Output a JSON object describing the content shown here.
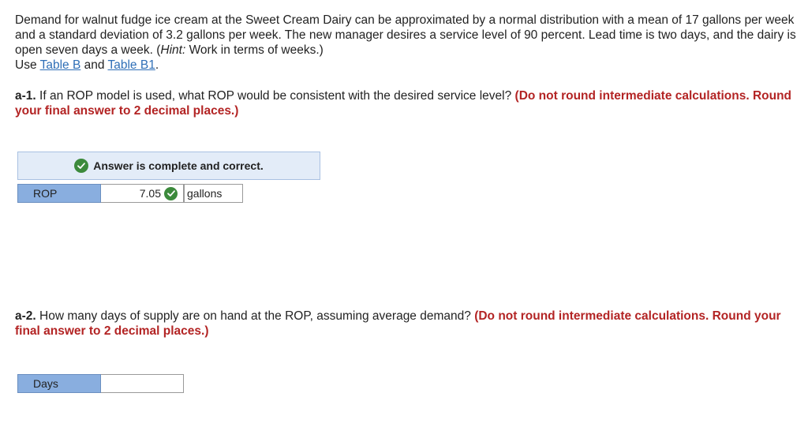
{
  "problem": {
    "text": "Demand for walnut fudge ice cream at the Sweet Cream Dairy can be approximated by a normal distribution with a mean of 17 gallons per week and a standard deviation of 3.2 gallons per week. The new manager desires a service level of 90 percent. Lead time is two days, and the dairy is open seven days a week. (",
    "hint_label": "Hint:",
    "hint_text": " Work in terms of weeks.)",
    "use_label": "Use ",
    "link1": "Table B",
    "and": " and ",
    "link2": "Table B1",
    "period": "."
  },
  "a1": {
    "num": "a-1.",
    "question": " If an ROP model is used, what ROP would be consistent with the desired service level? ",
    "instruction": "(Do not round intermediate calculations. Round your final answer to 2 decimal places.)",
    "banner": "Answer is complete and correct.",
    "row_label": "ROP",
    "value": "7.05",
    "unit": "gallons"
  },
  "a2": {
    "num": "a-2.",
    "question": " How many days of supply are on hand at the ROP, assuming average demand? ",
    "instruction": "(Do not round intermediate calculations. Round your final answer to 2 decimal places.)",
    "row_label": "Days",
    "value": ""
  },
  "colors": {
    "link": "#2f6fb7",
    "instruction": "#b32424",
    "label_bg": "#89aedf",
    "banner_bg": "#e3ecf8",
    "check": "#3c8a3c"
  }
}
